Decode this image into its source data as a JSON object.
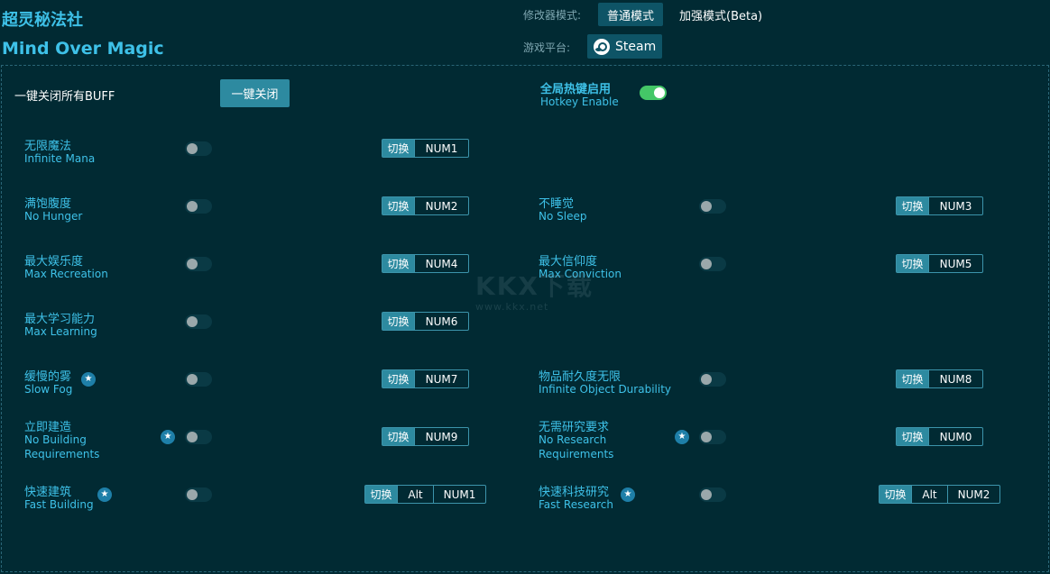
{
  "header": {
    "title_cn": "超灵秘法社",
    "title_en": "Mind Over Magic",
    "mode_label": "修改器模式:",
    "mode_normal": "普通模式",
    "mode_enhanced": "加强模式(Beta)",
    "platform_label": "游戏平台:",
    "platform": "Steam"
  },
  "controls": {
    "close_all_label": "一键关闭所有BUFF",
    "close_all_button": "一键关闭",
    "hotkey_cn": "全局热键启用",
    "hotkey_en": "Hotkey Enable"
  },
  "switch_label": "切换",
  "items": [
    {
      "cn": "无限魔法",
      "en": "Infinite Mana",
      "keys": [
        "NUM1"
      ]
    },
    {
      "cn": "满饱腹度",
      "en": "No Hunger",
      "keys": [
        "NUM2"
      ]
    },
    {
      "cn": "不睡觉",
      "en": "No Sleep",
      "keys": [
        "NUM3"
      ]
    },
    {
      "cn": "最大娱乐度",
      "en": "Max Recreation",
      "keys": [
        "NUM4"
      ]
    },
    {
      "cn": "最大信仰度",
      "en": "Max Conviction",
      "keys": [
        "NUM5"
      ]
    },
    {
      "cn": "最大学习能力",
      "en": "Max Learning",
      "keys": [
        "NUM6"
      ]
    },
    {
      "cn": "缓慢的雾",
      "en": "Slow Fog",
      "keys": [
        "NUM7"
      ]
    },
    {
      "cn": "物品耐久度无限",
      "en": "Infinite Object Durability",
      "keys": [
        "NUM8"
      ]
    },
    {
      "cn": "立即建造",
      "en": "No Building Requirements",
      "keys": [
        "NUM9"
      ]
    },
    {
      "cn": "无需研究要求",
      "en": "No Research Requirements",
      "keys": [
        "NUM0"
      ]
    },
    {
      "cn": "快速建筑",
      "en": "Fast Building",
      "keys": [
        "Alt",
        "NUM1"
      ]
    },
    {
      "cn": "快速科技研究",
      "en": "Fast Research",
      "keys": [
        "Alt",
        "NUM2"
      ]
    }
  ],
  "watermark": {
    "text": "KKX下载",
    "url": "www.kkx.net"
  }
}
